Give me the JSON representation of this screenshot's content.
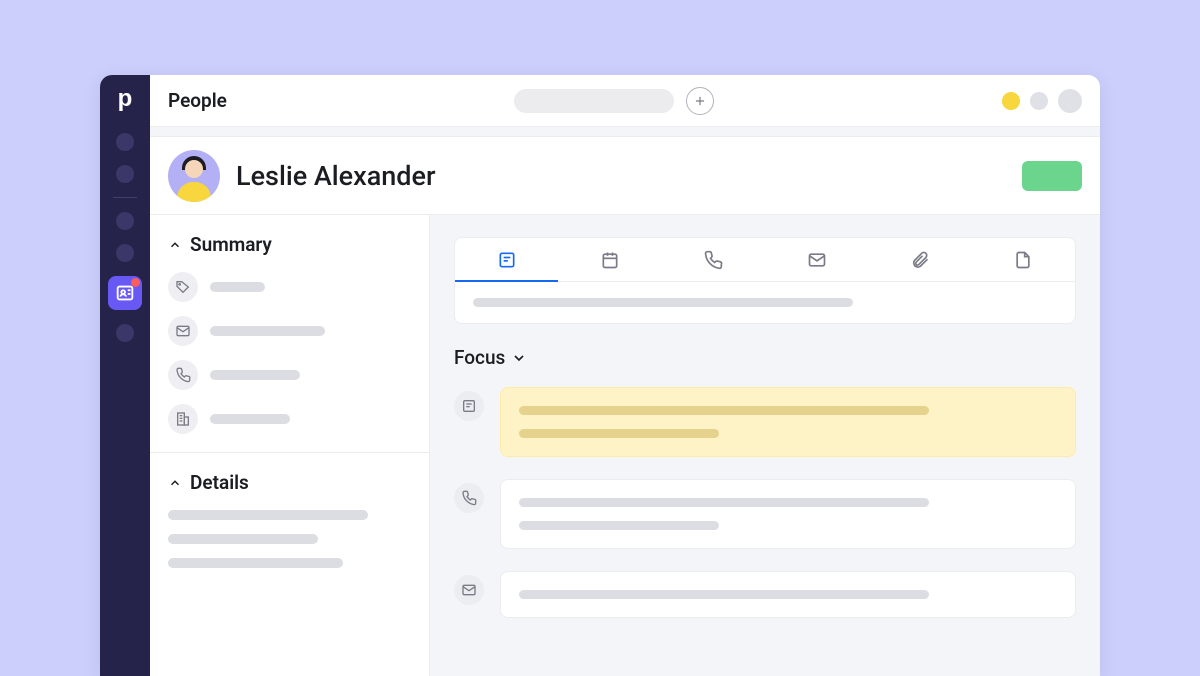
{
  "topbar": {
    "title": "People"
  },
  "record": {
    "name": "Leslie Alexander"
  },
  "sidebar": {
    "summary_heading": "Summary",
    "details_heading": "Details"
  },
  "content": {
    "focus_label": "Focus"
  },
  "tabs": {
    "note": "note",
    "calendar": "calendar",
    "phone": "phone",
    "email": "email",
    "attach": "attachment",
    "file": "file"
  },
  "colors": {
    "accent": "#1669F2",
    "success": "#6BD48D",
    "highlight": "#FEF3C7",
    "rail": "#26234A"
  }
}
